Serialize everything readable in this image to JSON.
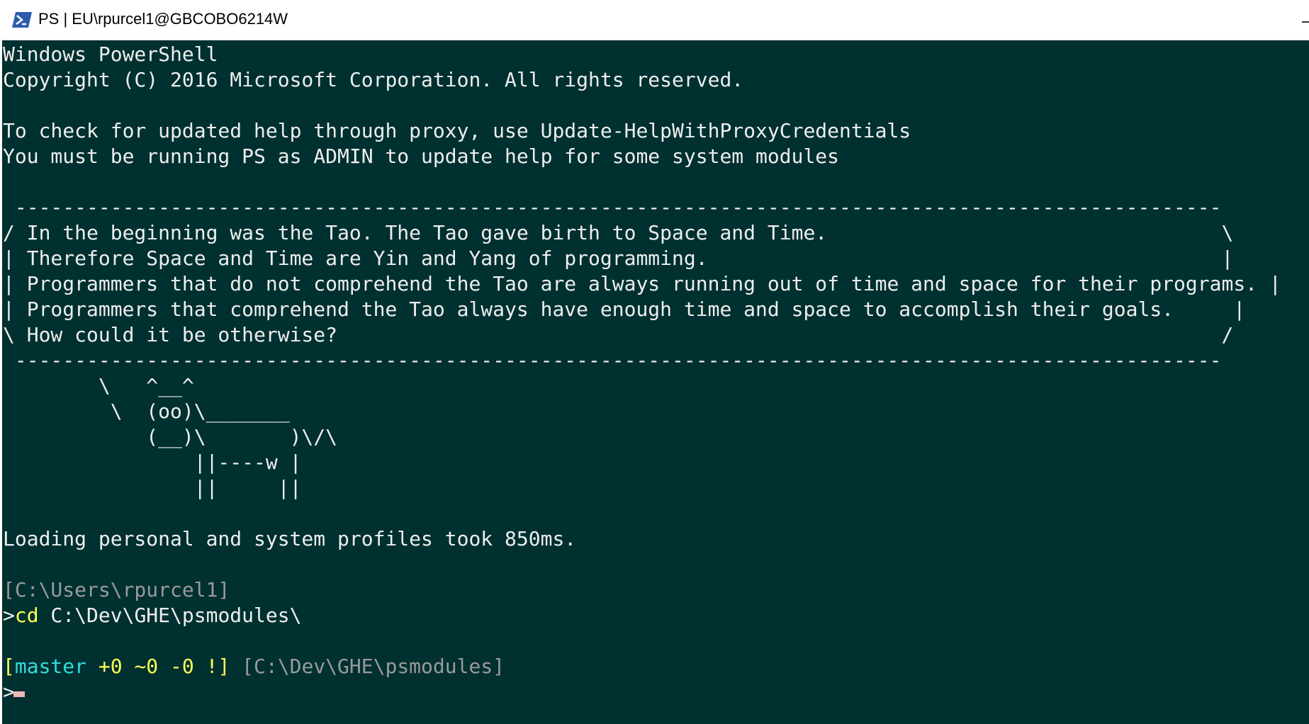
{
  "window": {
    "title": "PS | EU\\rpurcel1@GBCOBO6214W",
    "icon": "powershell-icon"
  },
  "colors": {
    "console_background": "#003030",
    "console_text": "#eeeeee",
    "prompt_path": "#9a9a9a",
    "command_keyword": "#ffff55",
    "git_branch": "#33dddd",
    "cursor": "#f0b8b8"
  },
  "console": {
    "lines": {
      "header_1": "Windows PowerShell",
      "header_2": "Copyright (C) 2016 Microsoft Corporation. All rights reserved.",
      "help_1": "To check for updated help through proxy, use Update-HelpWithProxyCredentials",
      "help_2": "You must be running PS as ADMIN to update help for some system modules",
      "cowsay_top": " -----------------------------------------------------------------------------------------------------",
      "cowsay_1": "/ In the beginning was the Tao. The Tao gave birth to Space and Time.                                 \\",
      "cowsay_2": "| Therefore Space and Time are Yin and Yang of programming.                                           |",
      "cowsay_3": "| Programmers that do not comprehend the Tao are always running out of time and space for their programs. |",
      "cowsay_4": "| Programmers that comprehend the Tao always have enough time and space to accomplish their goals.     |",
      "cowsay_5": "\\ How could it be otherwise?                                                                          /",
      "cowsay_bottom": " -----------------------------------------------------------------------------------------------------",
      "cow_1": "        \\   ^__^",
      "cow_2": "         \\  (oo)\\_______",
      "cow_3": "            (__)\\       )\\/\\",
      "cow_4": "                ||----w |",
      "cow_5": "                ||     ||",
      "profile_load": "Loading personal and system profiles took 850ms."
    },
    "prompt_1": {
      "path": "[C:\\Users\\rpurcel1]",
      "prefix": ">",
      "command": "cd",
      "argument": " C:\\Dev\\GHE\\psmodules\\"
    },
    "prompt_2": {
      "git_open": "[",
      "git_branch": "master",
      "git_status": " +0 ~0 -0 !",
      "git_close": "]",
      "path": " [C:\\Dev\\GHE\\psmodules]",
      "prefix": ">"
    }
  }
}
